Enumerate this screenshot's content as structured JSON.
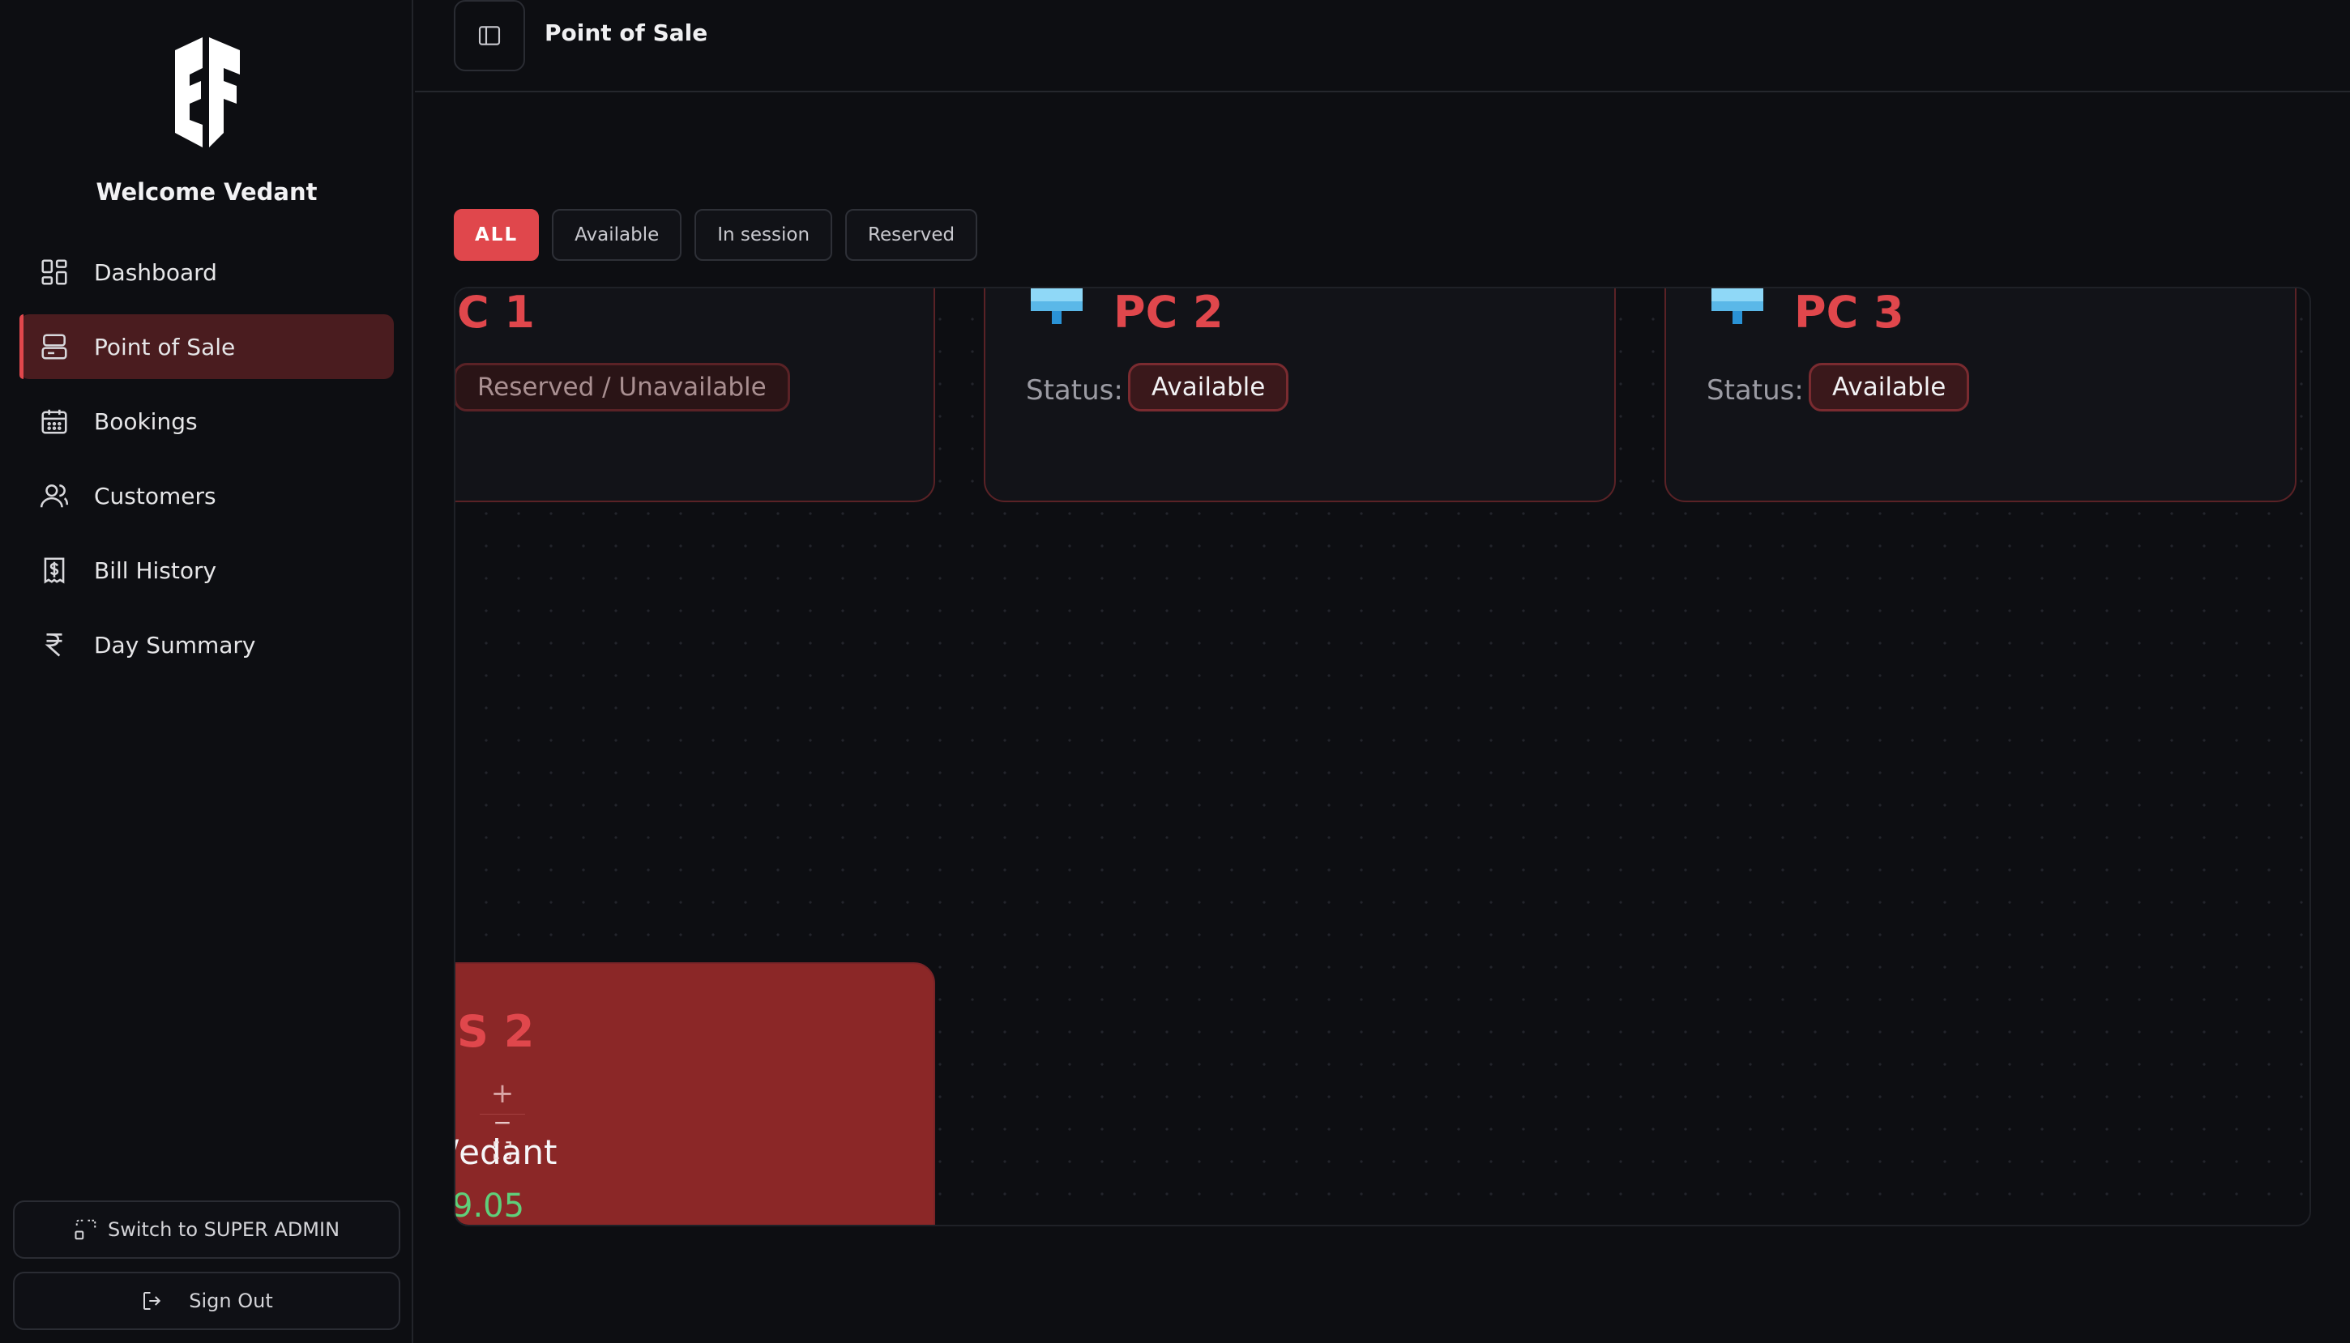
{
  "sidebar": {
    "welcome": "Welcome Vedant",
    "items": [
      {
        "label": "Dashboard",
        "icon": "dashboard-icon"
      },
      {
        "label": "Point of Sale",
        "icon": "pos-icon",
        "active": true
      },
      {
        "label": "Bookings",
        "icon": "calendar-icon"
      },
      {
        "label": "Customers",
        "icon": "users-icon"
      },
      {
        "label": "Bill History",
        "icon": "receipt-icon"
      },
      {
        "label": "Day Summary",
        "icon": "rupee-icon"
      }
    ],
    "switch_label": "Switch to SUPER ADMIN",
    "signout_label": "Sign Out"
  },
  "header": {
    "title": "Point of Sale"
  },
  "filters": [
    "ALL",
    "Available",
    "In session",
    "Reserved"
  ],
  "stations": [
    {
      "name": "C 1",
      "status_label": "",
      "status": "Reserved / Unavailable"
    },
    {
      "name": "PC 2",
      "status_label": "Status:",
      "status": "Available"
    },
    {
      "name": "PC 3",
      "status_label": "Status:",
      "status": "Available"
    }
  ],
  "session_card": {
    "name": "S 2",
    "user": "/edant",
    "amount": "9.05"
  },
  "colors": {
    "accent": "#e0474c",
    "active_nav": "#4a1c1f",
    "session_card": "#8b2727",
    "amount": "#5fcf7a"
  }
}
